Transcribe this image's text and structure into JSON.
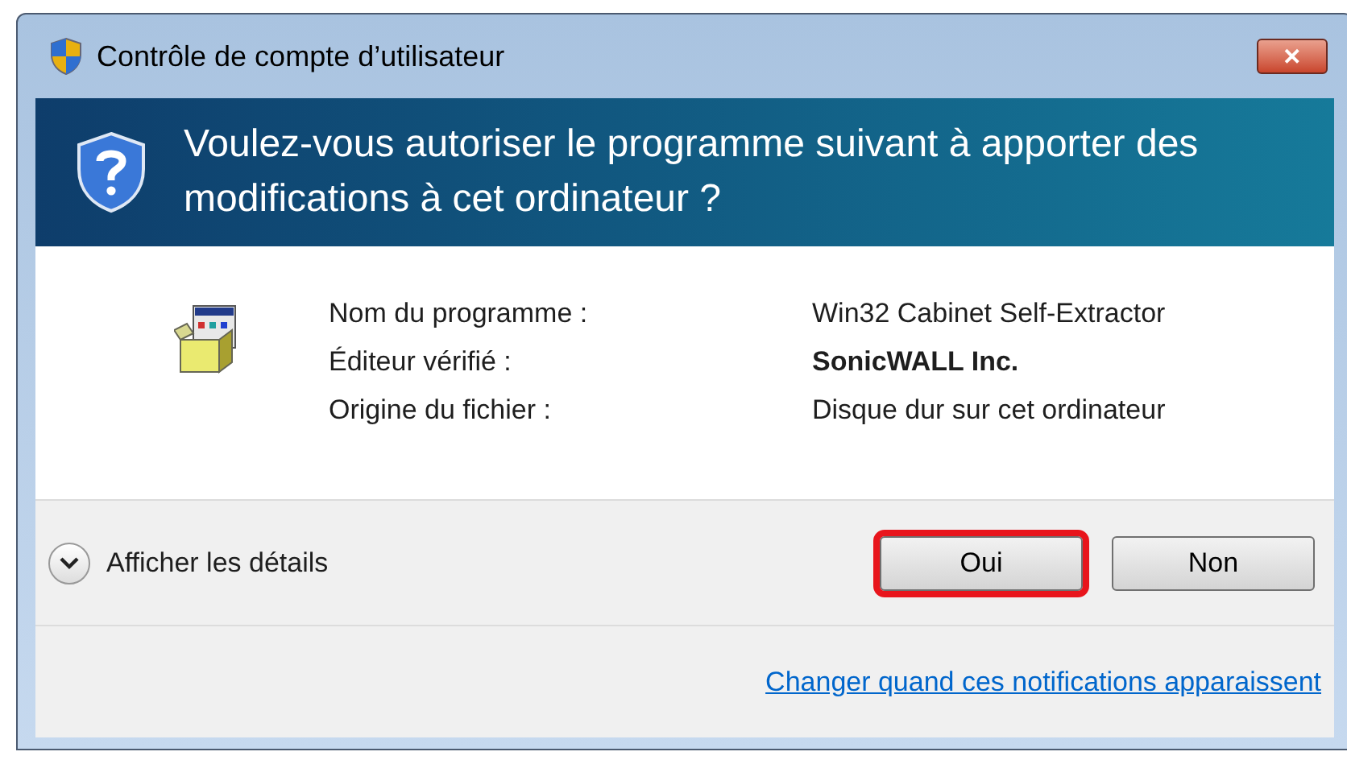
{
  "window": {
    "title": "Contrôle de compte d’utilisateur",
    "close_label": "✕"
  },
  "header": {
    "question": "Voulez-vous autoriser le programme suivant à apporter des modifications à cet ordinateur ?"
  },
  "details": [
    {
      "label": "Nom du programme :",
      "value": "Win32 Cabinet Self-Extractor",
      "bold": false
    },
    {
      "label": "Éditeur vérifié :",
      "value": "SonicWALL Inc.",
      "bold": true
    },
    {
      "label": "Origine du fichier :",
      "value": "Disque dur sur cet ordinateur",
      "bold": false
    }
  ],
  "show_details": {
    "label": "Afficher les détails",
    "expanded": false
  },
  "buttons": [
    {
      "label": "Oui",
      "highlighted": true
    },
    {
      "label": "Non",
      "highlighted": false
    }
  ],
  "link": "Changer quand ces notifications apparaissent"
}
